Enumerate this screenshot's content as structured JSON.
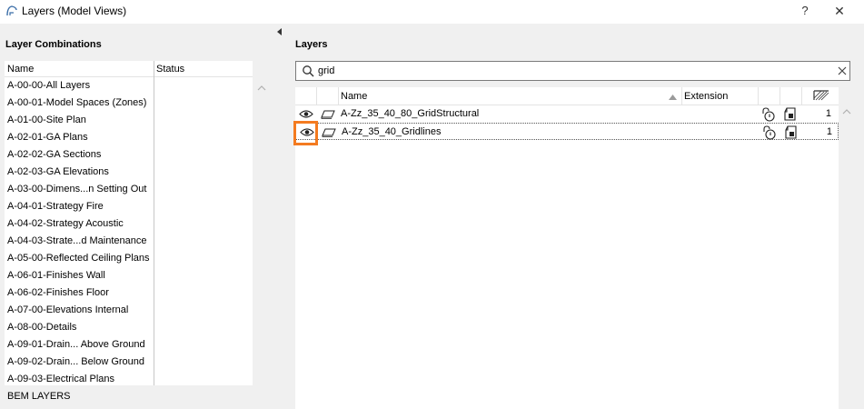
{
  "window": {
    "title": "Layers (Model Views)",
    "help_label": "?",
    "close_label": "✕",
    "icon": "archicad-arc-icon"
  },
  "combinations": {
    "title": "Layer Combinations",
    "col_name": "Name",
    "col_status": "Status",
    "items": [
      "A-00-00-All Layers",
      "A-00-01-Model Spaces (Zones)",
      "A-01-00-Site Plan",
      "A-02-01-GA Plans",
      "A-02-02-GA Sections",
      "A-02-03-GA Elevations",
      "A-03-00-Dimens...n Setting Out",
      "A-04-01-Strategy Fire",
      "A-04-02-Strategy Acoustic",
      "A-04-03-Strate...d Maintenance",
      "A-05-00-Reflected Ceiling Plans",
      "A-06-01-Finishes Wall",
      "A-06-02-Finishes Floor",
      "A-07-00-Elevations Internal",
      "A-08-00-Details",
      "A-09-01-Drain... Above Ground",
      "A-09-02-Drain... Below Ground",
      "A-09-03-Electrical Plans",
      "BEM LAYERS"
    ]
  },
  "layers": {
    "title": "Layers",
    "search": {
      "value": "grid",
      "placeholder": ""
    },
    "col_name": "Name",
    "col_extension": "Extension",
    "rows": [
      {
        "name": "A-Zz_35_40_80_GridStructural",
        "intersection": "1"
      },
      {
        "name": "A-Zz_35_40_Gridlines",
        "intersection": "1"
      }
    ]
  },
  "colors": {
    "highlight": "#f47b20",
    "panel_bg": "#f0f0f0"
  }
}
